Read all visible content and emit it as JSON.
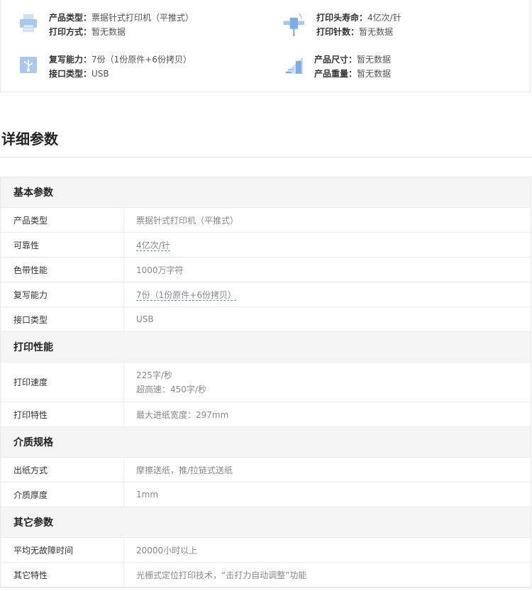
{
  "summary": [
    {
      "icon": "printer-icon",
      "lines": [
        {
          "label": "产品类型：",
          "value": "票据针式打印机（平推式）"
        },
        {
          "label": "打印方式：",
          "value": "暂无数据"
        }
      ]
    },
    {
      "icon": "print-head-icon",
      "lines": [
        {
          "label": "打印头寿命：",
          "value": "4亿次/针"
        },
        {
          "label": "打印针数：",
          "value": "暂无数据"
        }
      ]
    },
    {
      "icon": "usb-icon",
      "lines": [
        {
          "label": "复写能力：",
          "value": "7份（1份原件+6份拷贝）"
        },
        {
          "label": "接口类型：",
          "value": "USB"
        }
      ]
    },
    {
      "icon": "size-icon",
      "lines": [
        {
          "label": "产品尺寸：",
          "value": "暂无数据"
        },
        {
          "label": "产品重量：",
          "value": "暂无数据"
        }
      ]
    }
  ],
  "section_title": "详细参数",
  "groups": [
    {
      "title": "基本参数",
      "rows": [
        {
          "key": "产品类型",
          "values": [
            "票据针式打印机（平推式）"
          ]
        },
        {
          "key": "可靠性",
          "values": [
            "4亿次/针"
          ],
          "link": true
        },
        {
          "key": "色带性能",
          "values": [
            "1000万字符"
          ]
        },
        {
          "key": "复写能力",
          "values": [
            "7份（1份原件+6份拷贝）"
          ],
          "link": true
        },
        {
          "key": "接口类型",
          "values": [
            "USB"
          ]
        }
      ]
    },
    {
      "title": "打印性能",
      "rows": [
        {
          "key": "打印速度",
          "values": [
            "225字/秒",
            "超高速：450字/秒"
          ]
        },
        {
          "key": "打印特性",
          "values": [
            "最大进纸宽度：297mm"
          ]
        }
      ]
    },
    {
      "title": "介质规格",
      "rows": [
        {
          "key": "出纸方式",
          "values": [
            "摩擦送纸，推/拉链式送纸"
          ]
        },
        {
          "key": "介质厚度",
          "values": [
            "1mm"
          ]
        }
      ]
    },
    {
      "title": "其它参数",
      "rows": [
        {
          "key": "平均无故障时间",
          "values": [
            "20000小时以上"
          ]
        },
        {
          "key": "其它特性",
          "values": [
            "光栅式定位打印技术，“击打力自动调整”功能"
          ]
        }
      ]
    }
  ]
}
